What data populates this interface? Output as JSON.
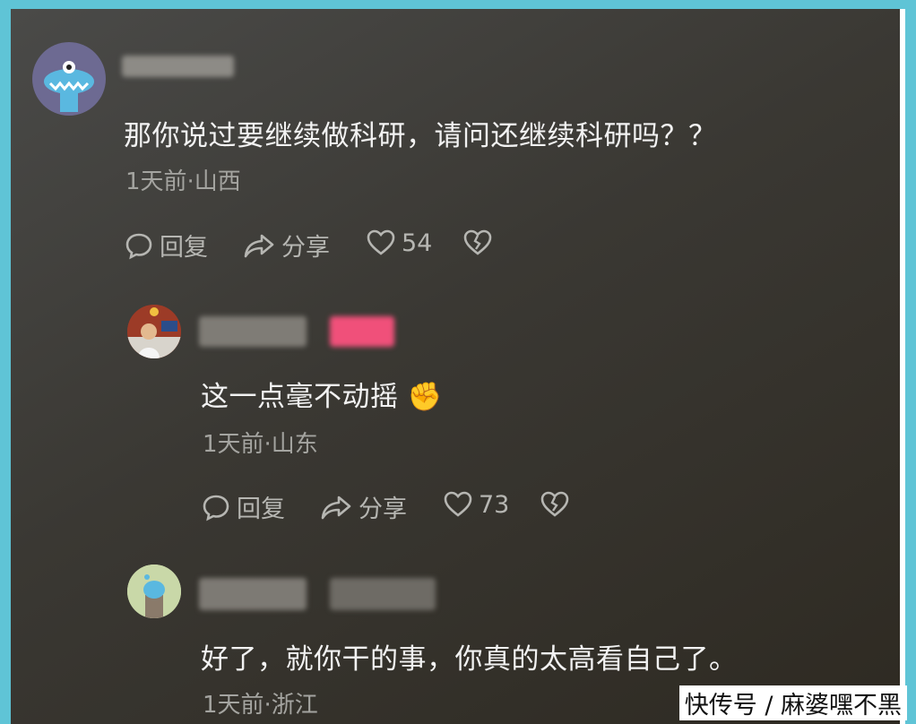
{
  "comments": [
    {
      "text": "那你说过要继续做科研，请问还继续科研吗？？",
      "meta": "1天前·山西",
      "reply_label": "回复",
      "share_label": "分享",
      "likes": "54"
    },
    {
      "text": "这一点毫不动摇 ✊",
      "meta": "1天前·山东",
      "reply_label": "回复",
      "share_label": "分享",
      "likes": "73"
    },
    {
      "text": "好了，就你干的事，你真的太高看自己了。",
      "meta": "1天前·浙江"
    }
  ],
  "watermark": "快传号 / 麻婆嘿不黑",
  "colors": {
    "frame": "#5fc4d6",
    "avatar1": "#6d6a92",
    "badge": "#f0507a",
    "avatar3": "#c9d8a8"
  },
  "icons": [
    "reply-icon",
    "share-icon",
    "heart-icon",
    "broken-heart-icon"
  ]
}
